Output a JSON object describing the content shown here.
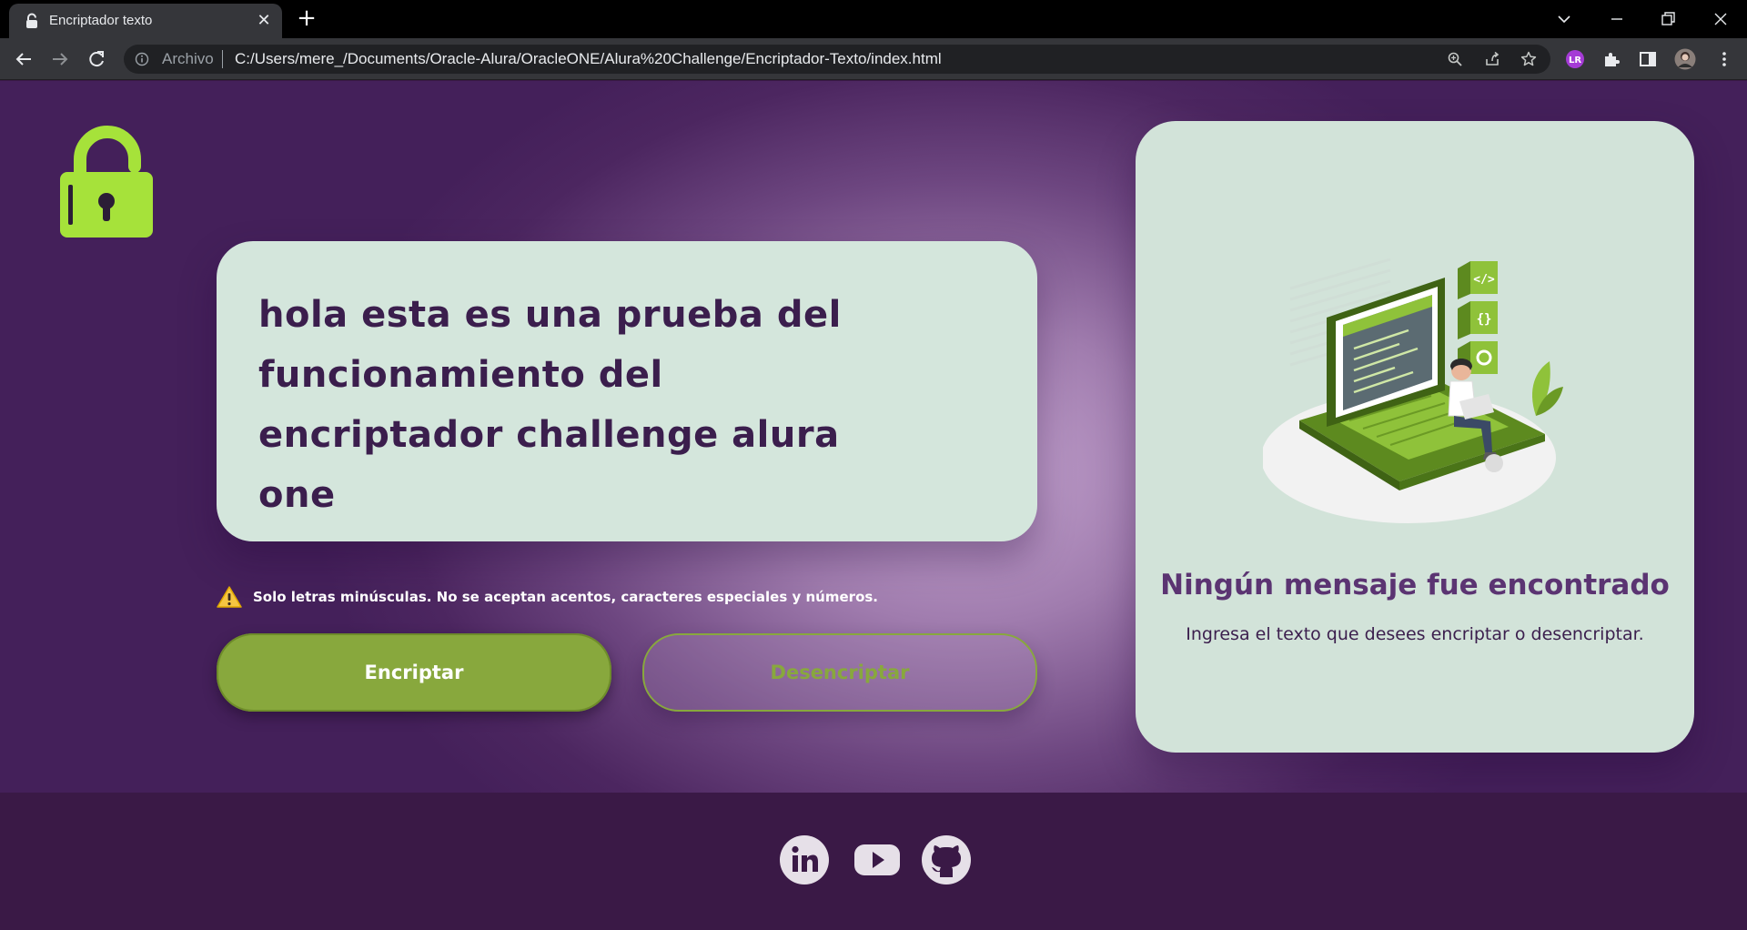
{
  "browser": {
    "tab_title": "Encriptador texto",
    "new_tab_symbol": "+",
    "close_symbol": "✕",
    "omnibox": {
      "scheme_label": "Archivo",
      "url": "C:/Users/mere_/Documents/Oracle-Alura/OracleONE/Alura%20Challenge/Encriptador-Texto/index.html"
    },
    "window_controls": [
      "minimize",
      "restore",
      "close"
    ]
  },
  "main": {
    "input_text": "hola esta es una prueba del funcionamiento del encriptador challenge alura one",
    "warning_text": "Solo letras minúsculas. No se aceptan acentos, caracteres especiales y números.",
    "encrypt_label": "Encriptar",
    "decrypt_label": "Desencriptar"
  },
  "output": {
    "title": "Ningún mensaje fue encontrado",
    "subtitle": "Ingresa el texto que desees encriptar o desencriptar."
  },
  "footer": {
    "social": [
      "linkedin-icon",
      "youtube-icon",
      "github-icon"
    ]
  },
  "colors": {
    "accent_green": "#88a83d",
    "logo_green": "#a6e23a",
    "panel_mint": "#d4e6dc",
    "deep_purple": "#3a1946",
    "text_purple": "#3b1e4d"
  }
}
